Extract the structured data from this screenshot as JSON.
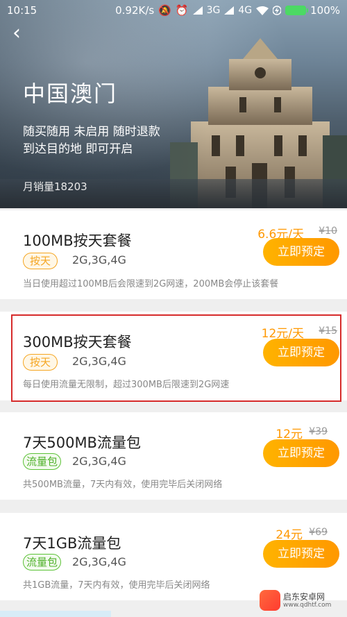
{
  "status": {
    "time": "10:15",
    "speed": "0.92K/s",
    "net1": "3G",
    "net2": "4G",
    "battery": "100%"
  },
  "hero": {
    "title": "中国澳门",
    "desc_line1": "随买随用 未启用 随时退款",
    "desc_line2": "到达目的地 即可开启",
    "sales": "月销量18203"
  },
  "plans": [
    {
      "name": "100MB按天套餐",
      "tag": "按天",
      "net": "2G,3G,4G",
      "desc": "当日使用超过100MB后会限速到2G网速，200MB会停止该套餐",
      "price": "6.6元/天",
      "old_price": "¥10",
      "button": "立即预定"
    },
    {
      "name": "300MB按天套餐",
      "tag": "按天",
      "net": "2G,3G,4G",
      "desc": "每日使用流量无限制，超过300MB后限速到2G网速",
      "price": "12元/天",
      "old_price": "¥15",
      "button": "立即预定"
    },
    {
      "name": "7天500MB流量包",
      "tag": "流量包",
      "net": "2G,3G,4G",
      "desc": "共500MB流量，7天内有效，使用完毕后关闭网络",
      "price": "12元",
      "old_price": "¥39",
      "button": "立即预定"
    },
    {
      "name": "7天1GB流量包",
      "tag": "流量包",
      "net": "2G,3G,4G",
      "desc": "共1GB流量，7天内有效，使用完毕后关闭网络",
      "price": "24元",
      "old_price": "¥69",
      "button": "立即预定"
    }
  ],
  "watermark": {
    "name": "启东安卓网",
    "url": "www.qdhtf.com"
  },
  "colors": {
    "accent": "#ff9800",
    "highlight": "#d62b2b",
    "day_tag": "#f5a623",
    "pack_tag": "#5bc236"
  }
}
